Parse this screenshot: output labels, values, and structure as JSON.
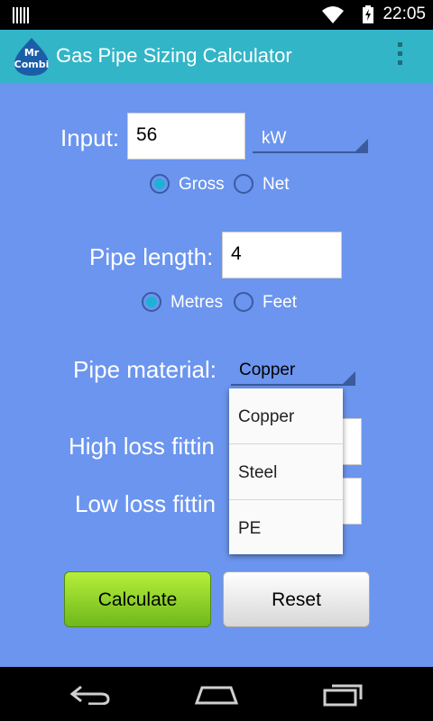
{
  "status_bar": {
    "time": "22:05"
  },
  "app_bar": {
    "icon_text_top": "Mr",
    "icon_text_bottom": "Combi",
    "title": "Gas Pipe Sizing Calculator"
  },
  "input_section": {
    "label": "Input:",
    "value": "56",
    "unit": "kW",
    "options": [
      {
        "label": "Gross",
        "checked": true
      },
      {
        "label": "Net",
        "checked": false
      }
    ]
  },
  "pipe_length": {
    "label": "Pipe length:",
    "value": "4",
    "options": [
      {
        "label": "Metres",
        "checked": true
      },
      {
        "label": "Feet",
        "checked": false
      }
    ]
  },
  "pipe_material": {
    "label": "Pipe material:",
    "value": "Copper",
    "dropdown_items": [
      "Copper",
      "Steel",
      "PE"
    ]
  },
  "high_loss": {
    "label": "High loss fittin"
  },
  "low_loss": {
    "label": "Low loss fittin"
  },
  "buttons": {
    "calculate": "Calculate",
    "reset": "Reset"
  },
  "colors": {
    "background": "#6b95ee",
    "action_bar": "#32b5c7",
    "calculate": "#8fd42a"
  }
}
